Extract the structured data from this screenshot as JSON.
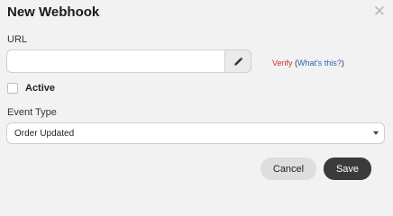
{
  "dialog": {
    "title": "New Webhook",
    "close_icon": "close-icon"
  },
  "url": {
    "label": "URL",
    "value": "",
    "edit_icon": "pencil-icon",
    "verify_label": "Verify",
    "open_paren": "(",
    "whats_this": "What's this?",
    "close_paren": ")"
  },
  "active": {
    "label": "Active",
    "checked": false
  },
  "event_type": {
    "label": "Event Type",
    "selected": "Order Updated"
  },
  "actions": {
    "cancel_label": "Cancel",
    "save_label": "Save"
  },
  "colors": {
    "verify": "#d03333",
    "link": "#2f5fb5",
    "primary_button": "#3a3a3a",
    "secondary_button": "#dedede",
    "background": "#f2f2f2"
  }
}
